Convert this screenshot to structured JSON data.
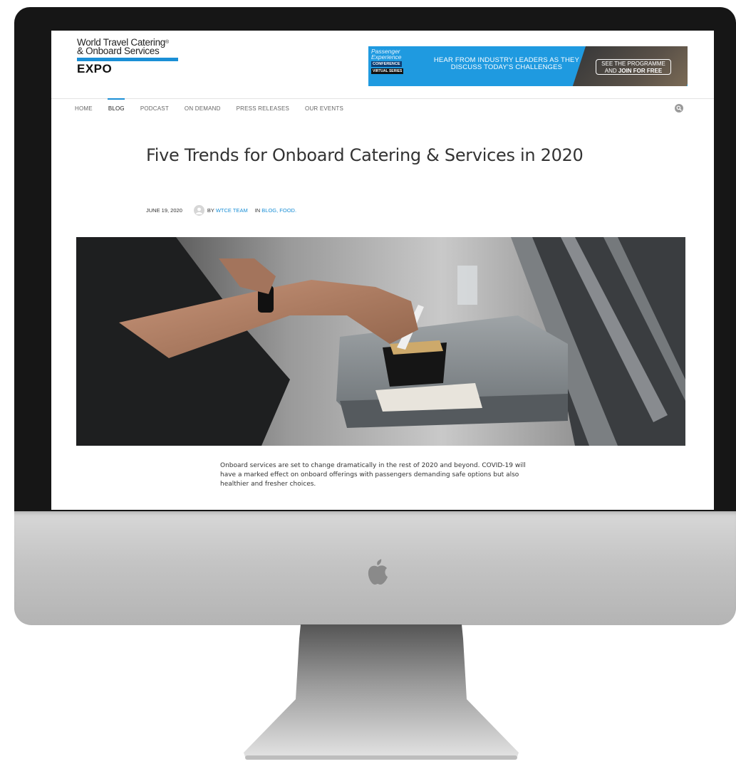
{
  "site": {
    "logo_line1": "World Travel Catering",
    "logo_line2": "& Onboard Services",
    "logo_line3": "EXPO",
    "logo_reg": "®"
  },
  "banner": {
    "brand_line1": "Passenger",
    "brand_line2": "Experience",
    "brand_conference": "CONFERENCE",
    "brand_series": "VIRTUAL SERIES",
    "message_line1": "HEAR FROM INDUSTRY LEADERS AS THEY",
    "message_line2": "DISCUSS TODAY'S CHALLENGES",
    "cta_line1": "SEE THE PROGRAMME",
    "cta_line2_prefix": "AND ",
    "cta_line2_bold": "JOIN FOR FREE",
    "accent_color": "#1f9ae0"
  },
  "nav": {
    "items": [
      {
        "label": "HOME"
      },
      {
        "label": "BLOG"
      },
      {
        "label": "PODCAST"
      },
      {
        "label": "ON DEMAND"
      },
      {
        "label": "PRESS RELEASES"
      },
      {
        "label": "OUR EVENTS"
      }
    ],
    "active": "BLOG",
    "search_icon": "search-icon"
  },
  "article": {
    "title": "Five Trends for Onboard Catering & Services in 2020",
    "date": "JUNE 19, 2020",
    "by_prefix": "BY ",
    "author": "WTCE TEAM",
    "in_prefix": "IN ",
    "categories": "BLOG, FOOD.",
    "paragraph1": "Onboard services are set to change dramatically in the rest of 2020 and beyond. COVID-19 will have a marked effect on onboard offerings with passengers demanding safe options but also healthier and fresher choices."
  },
  "colors": {
    "link": "#1b8fd6",
    "bezel": "#161616"
  }
}
